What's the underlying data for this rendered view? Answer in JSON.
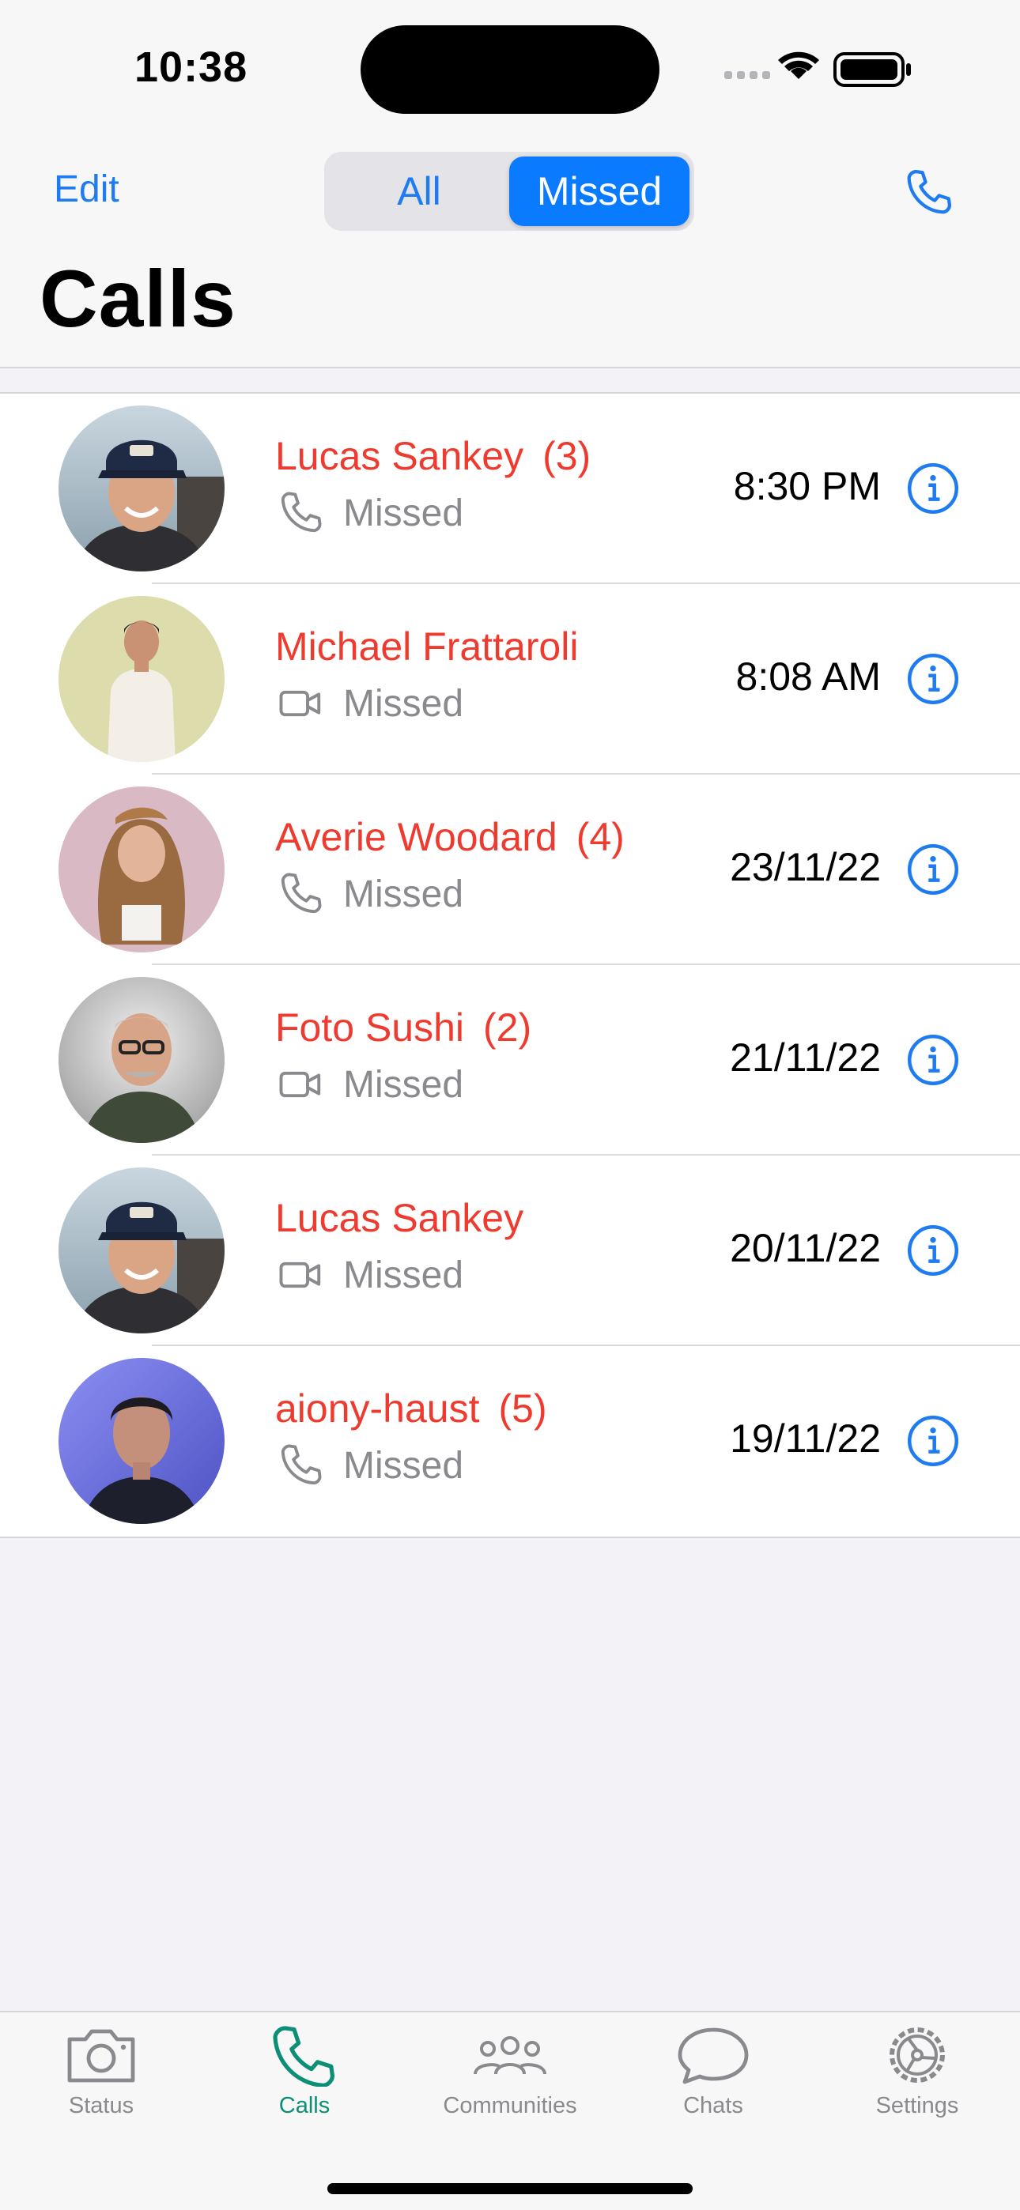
{
  "status_bar": {
    "time": "10:38"
  },
  "nav": {
    "edit_label": "Edit",
    "segments": [
      "All",
      "Missed"
    ],
    "selected_segment": "Missed",
    "title": "Calls",
    "new_call_icon": "phone-plus-icon"
  },
  "colors": {
    "accent": "#1e7cf0",
    "missed": "#ee3b30",
    "active_tab": "#0d8f77"
  },
  "calls": [
    {
      "name": "Lucas Sankey",
      "count": "(3)",
      "type_icon": "phone-icon",
      "status": "Missed",
      "time": "8:30 PM"
    },
    {
      "name": "Michael Frattaroli",
      "count": "",
      "type_icon": "video-icon",
      "status": "Missed",
      "time": "8:08 AM"
    },
    {
      "name": "Averie Woodard",
      "count": "(4)",
      "type_icon": "phone-icon",
      "status": "Missed",
      "time": "23/11/22"
    },
    {
      "name": "Foto Sushi",
      "count": "(2)",
      "type_icon": "video-icon",
      "status": "Missed",
      "time": "21/11/22"
    },
    {
      "name": "Lucas Sankey",
      "count": "",
      "type_icon": "video-icon",
      "status": "Missed",
      "time": "20/11/22"
    },
    {
      "name": "aiony-haust",
      "count": "(5)",
      "type_icon": "phone-icon",
      "status": "Missed",
      "time": "19/11/22"
    }
  ],
  "tabs": [
    {
      "label": "Status",
      "icon": "camera-icon",
      "active": false
    },
    {
      "label": "Calls",
      "icon": "phone-icon",
      "active": true
    },
    {
      "label": "Communities",
      "icon": "people-icon",
      "active": false
    },
    {
      "label": "Chats",
      "icon": "chat-bubble-icon",
      "active": false
    },
    {
      "label": "Settings",
      "icon": "gear-icon",
      "active": false
    }
  ]
}
